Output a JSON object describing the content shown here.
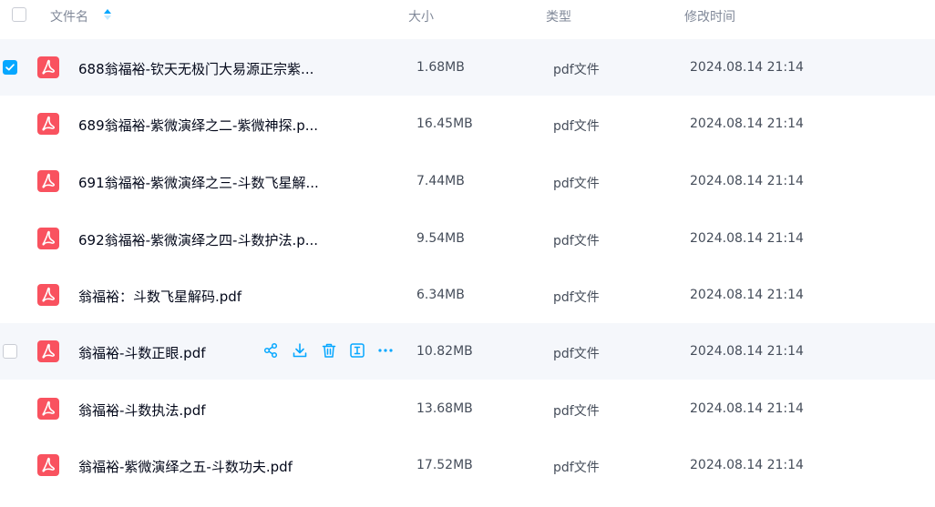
{
  "header": {
    "name_label": "文件名",
    "size_label": "大小",
    "type_label": "类型",
    "time_label": "修改时间"
  },
  "files": [
    {
      "name": "688翁福裕-钦天无极门大易源正宗紫...",
      "size": "1.68MB",
      "type": "pdf文件",
      "modified": "2024.08.14 21:14",
      "checked": true
    },
    {
      "name": "689翁福裕-紫微演绎之二-紫微神探.p...",
      "size": "16.45MB",
      "type": "pdf文件",
      "modified": "2024.08.14 21:14",
      "checked": false
    },
    {
      "name": "691翁福裕-紫微演绎之三-斗数飞星解...",
      "size": "7.44MB",
      "type": "pdf文件",
      "modified": "2024.08.14 21:14",
      "checked": false
    },
    {
      "name": "692翁福裕-紫微演绎之四-斗数护法.p...",
      "size": "9.54MB",
      "type": "pdf文件",
      "modified": "2024.08.14 21:14",
      "checked": false
    },
    {
      "name": "翁福裕：斗数飞星解码.pdf",
      "size": "6.34MB",
      "type": "pdf文件",
      "modified": "2024.08.14 21:14",
      "checked": false
    },
    {
      "name": "翁福裕-斗数正眼.pdf",
      "size": "10.82MB",
      "type": "pdf文件",
      "modified": "2024.08.14 21:14",
      "checked": false,
      "hovered": true
    },
    {
      "name": "翁福裕-斗数执法.pdf",
      "size": "13.68MB",
      "type": "pdf文件",
      "modified": "2024.08.14 21:14",
      "checked": false
    },
    {
      "name": "翁福裕-紫微演绎之五-斗数功夫.pdf",
      "size": "17.52MB",
      "type": "pdf文件",
      "modified": "2024.08.14 21:14",
      "checked": false
    }
  ],
  "row_actions": [
    "share-icon",
    "download-icon",
    "delete-icon",
    "rename-icon",
    "more-icon"
  ],
  "colors": {
    "accent": "#06a7ff",
    "pdf_icon": "#f9525f",
    "row_highlight": "#f5f7fb",
    "header_text": "#818999"
  }
}
